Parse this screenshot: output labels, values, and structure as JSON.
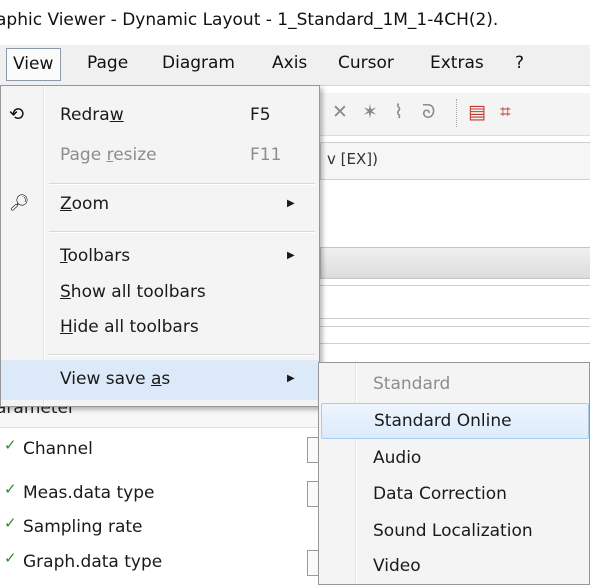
{
  "window": {
    "title": "aphic Viewer - Dynamic Layout - 1_Standard_1M_1-4CH(2)."
  },
  "menubar": {
    "items": [
      {
        "label": "View",
        "active": true
      },
      {
        "label": "Page"
      },
      {
        "label": "Diagram"
      },
      {
        "label": "Axis"
      },
      {
        "label": "Cursor"
      },
      {
        "label": "Extras"
      },
      {
        "label": "?"
      }
    ]
  },
  "view_menu": {
    "items": [
      {
        "pre": "Redra",
        "key": "w",
        "post": "",
        "shortcut": "F5",
        "icon": "redraw-icon",
        "enabled": true
      },
      {
        "pre": "Page ",
        "key": "r",
        "post": "esize",
        "shortcut": "F11",
        "enabled": false
      },
      {
        "pre": "",
        "key": "Z",
        "post": "oom",
        "icon": "zoom-icon",
        "submenu": true,
        "enabled": true
      },
      {
        "pre": "",
        "key": "T",
        "post": "oolbars",
        "submenu": true,
        "enabled": true
      },
      {
        "pre": "",
        "key": "S",
        "post": "how all toolbars",
        "enabled": true
      },
      {
        "pre": "",
        "key": "H",
        "post": "ide all toolbars",
        "enabled": true
      },
      {
        "pre": "View save ",
        "key": "a",
        "post": "s",
        "submenu": true,
        "highlighted": true,
        "enabled": true
      }
    ]
  },
  "view_save_as_submenu": {
    "items": [
      {
        "label": "Standard",
        "enabled": false
      },
      {
        "label": "Standard Online",
        "highlighted": true
      },
      {
        "label": "Audio"
      },
      {
        "label": "Data Correction"
      },
      {
        "label": "Sound Localization"
      },
      {
        "label": "Video"
      }
    ]
  },
  "background": {
    "tab_text": "v [EX])",
    "parameter_header": "arameter",
    "parameters": [
      "Channel",
      "Meas.data type",
      "Sampling rate",
      "Graph.data type"
    ]
  },
  "colors": {
    "highlight": "#dbe9f8",
    "submenu_highlight_border": "#a8cbee",
    "check": "#2e8b2e"
  }
}
